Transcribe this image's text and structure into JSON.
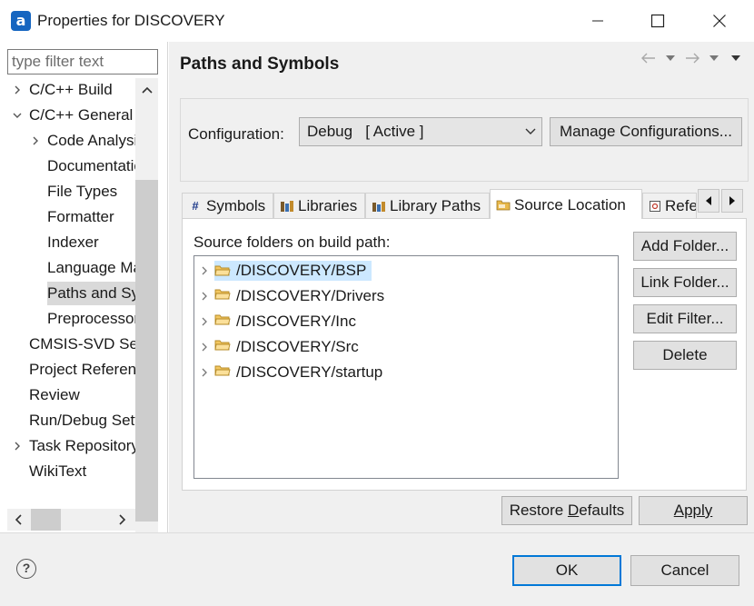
{
  "window": {
    "title": "Properties for DISCOVERY",
    "icon": "a",
    "controls": [
      "minimize-icon",
      "maximize-icon",
      "close-icon"
    ]
  },
  "filter": {
    "placeholder": "type filter text",
    "value": ""
  },
  "tree": [
    {
      "label": "C/C++ Build",
      "level": 0,
      "expander": "collapsed"
    },
    {
      "label": "C/C++ General",
      "level": 0,
      "expander": "expanded"
    },
    {
      "label": "Code Analysis",
      "level": 1,
      "expander": "collapsed"
    },
    {
      "label": "Documentation",
      "level": 1,
      "expander": "none"
    },
    {
      "label": "File Types",
      "level": 1,
      "expander": "none"
    },
    {
      "label": "Formatter",
      "level": 1,
      "expander": "none"
    },
    {
      "label": "Indexer",
      "level": 1,
      "expander": "none"
    },
    {
      "label": "Language Mappings",
      "level": 1,
      "expander": "none"
    },
    {
      "label": "Paths and Symbols",
      "level": 1,
      "expander": "none",
      "selected": true
    },
    {
      "label": "Preprocessor Include Paths",
      "level": 1,
      "expander": "none"
    },
    {
      "label": "CMSIS-SVD Settings",
      "level": 0,
      "expander": "none"
    },
    {
      "label": "Project References",
      "level": 0,
      "expander": "none"
    },
    {
      "label": "Review",
      "level": 0,
      "expander": "none"
    },
    {
      "label": "Run/Debug Settings",
      "level": 0,
      "expander": "none"
    },
    {
      "label": "Task Repository",
      "level": 0,
      "expander": "collapsed"
    },
    {
      "label": "WikiText",
      "level": 0,
      "expander": "none"
    }
  ],
  "page": {
    "title": "Paths and Symbols",
    "nav_icons": [
      "back-arrow-icon",
      "back-menu-icon",
      "forward-arrow-icon",
      "forward-menu-icon",
      "view-menu-icon"
    ]
  },
  "configuration": {
    "label": "Configuration:",
    "selected": "Debug   [ Active ]",
    "manage_label": "Manage Configurations..."
  },
  "tabs": [
    {
      "label": "Symbols",
      "icon": "hash-icon"
    },
    {
      "label": "Libraries",
      "icon": "library-icon"
    },
    {
      "label": "Library Paths",
      "icon": "library-path-icon"
    },
    {
      "label": "Source Location",
      "icon": "source-folder-icon",
      "active": true
    },
    {
      "label": "References",
      "icon": "references-icon"
    }
  ],
  "source_location": {
    "label": "Source folders on build path:",
    "folders": [
      {
        "path": "/DISCOVERY/BSP",
        "selected": true
      },
      {
        "path": "/DISCOVERY/Drivers"
      },
      {
        "path": "/DISCOVERY/Inc"
      },
      {
        "path": "/DISCOVERY/Src"
      },
      {
        "path": "/DISCOVERY/startup"
      }
    ],
    "buttons": {
      "add_folder": "Add Folder...",
      "link_folder": "Link Folder...",
      "edit_filter": "Edit Filter...",
      "delete": "Delete"
    }
  },
  "actions": {
    "restore_defaults": "Restore Defaults",
    "apply": "Apply"
  },
  "dialog": {
    "ok": "OK",
    "cancel": "Cancel"
  },
  "colors": {
    "selection": "#cce8ff",
    "tree_selection": "#d9d9d9",
    "default_button_border": "#0078d7",
    "pane_background": "#f0f0f0"
  }
}
